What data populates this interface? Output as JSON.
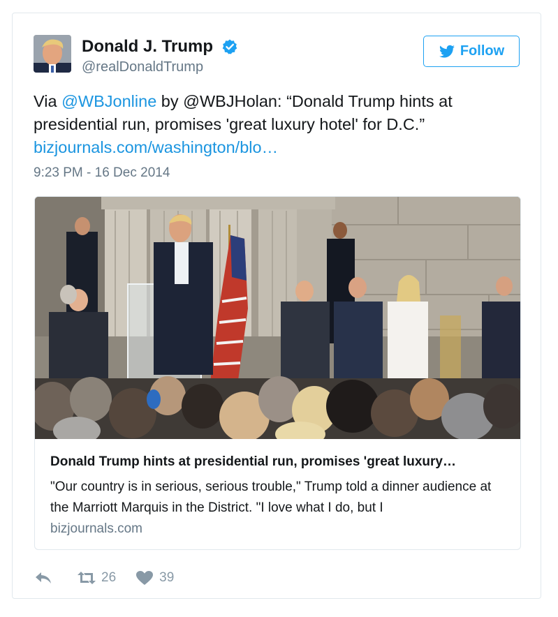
{
  "author": {
    "name": "Donald J. Trump",
    "handle": "@realDonaldTrump",
    "verified": true
  },
  "follow_button": {
    "label": "Follow",
    "icon": "twitter-bird-icon"
  },
  "tweet": {
    "prefix": "Via ",
    "mention1": "@WBJonline",
    "middle": " by @WBJHolan: “Donald Trump hints at presidential run, promises 'great luxury hotel' for D.C.”",
    "link": "bizjournals.com/washington/blo…",
    "timestamp": "9:23 PM - 16 Dec 2014"
  },
  "card": {
    "title": "Donald Trump hints at presidential run, promises 'great luxury…",
    "description": "\"Our country is in serious, serious trouble,\" Trump told a dinner audience at the Marriott Marquis in the District. \"I love what I do, but I",
    "domain": "bizjournals.com"
  },
  "actions": {
    "reply_icon": "reply-icon",
    "retweet_icon": "retweet-icon",
    "retweet_count": "26",
    "like_icon": "heart-icon",
    "like_count": "39"
  },
  "colors": {
    "link": "#1b95e0",
    "accent": "#1da1f2",
    "muted": "#657786",
    "action_gray": "#8899a6"
  }
}
